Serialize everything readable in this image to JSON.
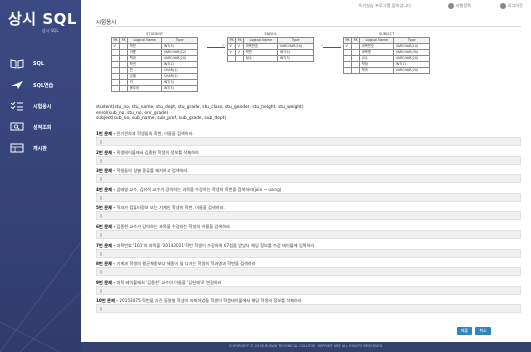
{
  "app": {
    "logo": "상시 SQL",
    "logo_sub": "상시 SQL"
  },
  "sidebar": {
    "items": [
      {
        "label": "SQL",
        "icon": "book-icon"
      },
      {
        "label": "SQL연습",
        "icon": "plane-icon"
      },
      {
        "label": "시험응시",
        "icon": "list-check-icon"
      },
      {
        "label": "성적조회",
        "icon": "search-monitor-icon"
      },
      {
        "label": "게시판",
        "icon": "board-icon"
      }
    ]
  },
  "topbar": {
    "welcome": "독거실습 프로그램 접속입니다",
    "user": "자행정쪽",
    "logout": "로그아웃"
  },
  "page": {
    "title": "시험응시"
  },
  "schema": {
    "student": {
      "title": "STUDENT",
      "headers": [
        "PK",
        "FK",
        "Logical Name",
        "Type"
      ],
      "rows": [
        [
          "V",
          "",
          "학번",
          "INT(5)"
        ],
        [
          "",
          "",
          "이름",
          "VARCHAR(12)"
        ],
        [
          "",
          "",
          "학과",
          "VARCHAR(20)"
        ],
        [
          "",
          "",
          "학년",
          "INT(1)"
        ],
        [
          "",
          "",
          "반",
          "CHAR(1)"
        ],
        [
          "",
          "",
          "성별",
          "CHAR(1)"
        ],
        [
          "",
          "",
          "키",
          "INT(3)"
        ],
        [
          "",
          "",
          "몸무게",
          "INT(3)"
        ]
      ]
    },
    "enrol": {
      "title": "ENROL",
      "headers": [
        "PK",
        "FK",
        "Logical Name",
        "Type"
      ],
      "rows": [
        [
          "V",
          "V",
          "과목번호",
          "VARCHAR(10)"
        ],
        [
          "V",
          "V",
          "학번",
          "INT(5)"
        ],
        [
          "",
          "",
          "점수",
          "INT(3)"
        ]
      ]
    },
    "subject": {
      "title": "SUBJECT",
      "headers": [
        "PK",
        "FK",
        "Logical Name",
        "Type"
      ],
      "rows": [
        [
          "V",
          "",
          "과목번호",
          "VARCHAR(10)"
        ],
        [
          "",
          "",
          "과목명",
          "VARCHAR(30)"
        ],
        [
          "",
          "",
          "교수",
          "VARCHAR(20)"
        ],
        [
          "",
          "",
          "학점",
          "INT(1)"
        ],
        [
          "",
          "",
          "학과",
          "VARCHAR(20)"
        ]
      ]
    }
  },
  "relations": [
    "student(stu_no, stu_name, stu_dept, stu_grade, stu_class, stu_gender, stu_height, stu_weight)",
    "enrol(sub_no, stu_no, enr_grade)",
    "subject(sub_no, sub_name, sub_prof, sub_grade, sub_dept)"
  ],
  "questions": [
    {
      "num": "1번 문제 -",
      "text": " 전기전자과 학생들의 학번, 이름을 검색하라."
    },
    {
      "num": "2번 문제 -",
      "text": " 학생테이블에서 김종헌 학생의 정보를 삭제하라"
    },
    {
      "num": "3번 문제 -",
      "text": " 학생들의 성별 종류를 제거하고 검색하라."
    },
    {
      "num": "4번 문제 -",
      "text": " 김태영 교수, 김유석 교수가 강의하는 과목을 수강하는 학생의 학번을 검색하라(join ~ using)"
    },
    {
      "num": "5번 문제 -",
      "text": " 학과가 컴퓨터정보 또는 기계인 학생의 학번, 이름을 검색하라."
    },
    {
      "num": "6번 문제 -",
      "text": " 김종헌 교수가 강의하는 과목을 수강하는 학생의 이름을 검색하라."
    },
    {
      "num": "7번 문제 -",
      "text": " 과목번호 '101'의 과목을 '20142021'학번 학생이 수강하여 67점을 받았다 해당 정보를 수강 테이블에 입력하라."
    },
    {
      "num": "8번 문제 -",
      "text": " 기계과 학생의 평균체중보다 체중이 덜 나가는 학생의 학과명과 학번을 검색하라"
    },
    {
      "num": "9번 문제 -",
      "text": " 과목 테이블에서 '김종헌' 교수의 이름을 '김헌재'로 변경하라"
    },
    {
      "num": "10번 문제 -",
      "text": " 20153075 학번을 가진 동명칠 학생이 자퇴하였을 학생이 학생테이블에서 해당 학생의 정보를 삭제하라"
    }
  ],
  "buttons": {
    "submit": "제출",
    "cancel": "취소"
  },
  "footer": {
    "text": "COPYRIGHT © 2018 BUSAN TECHNICAL COLLEGE. REPRINT ARE ALL RIGHTS RESERVED."
  }
}
